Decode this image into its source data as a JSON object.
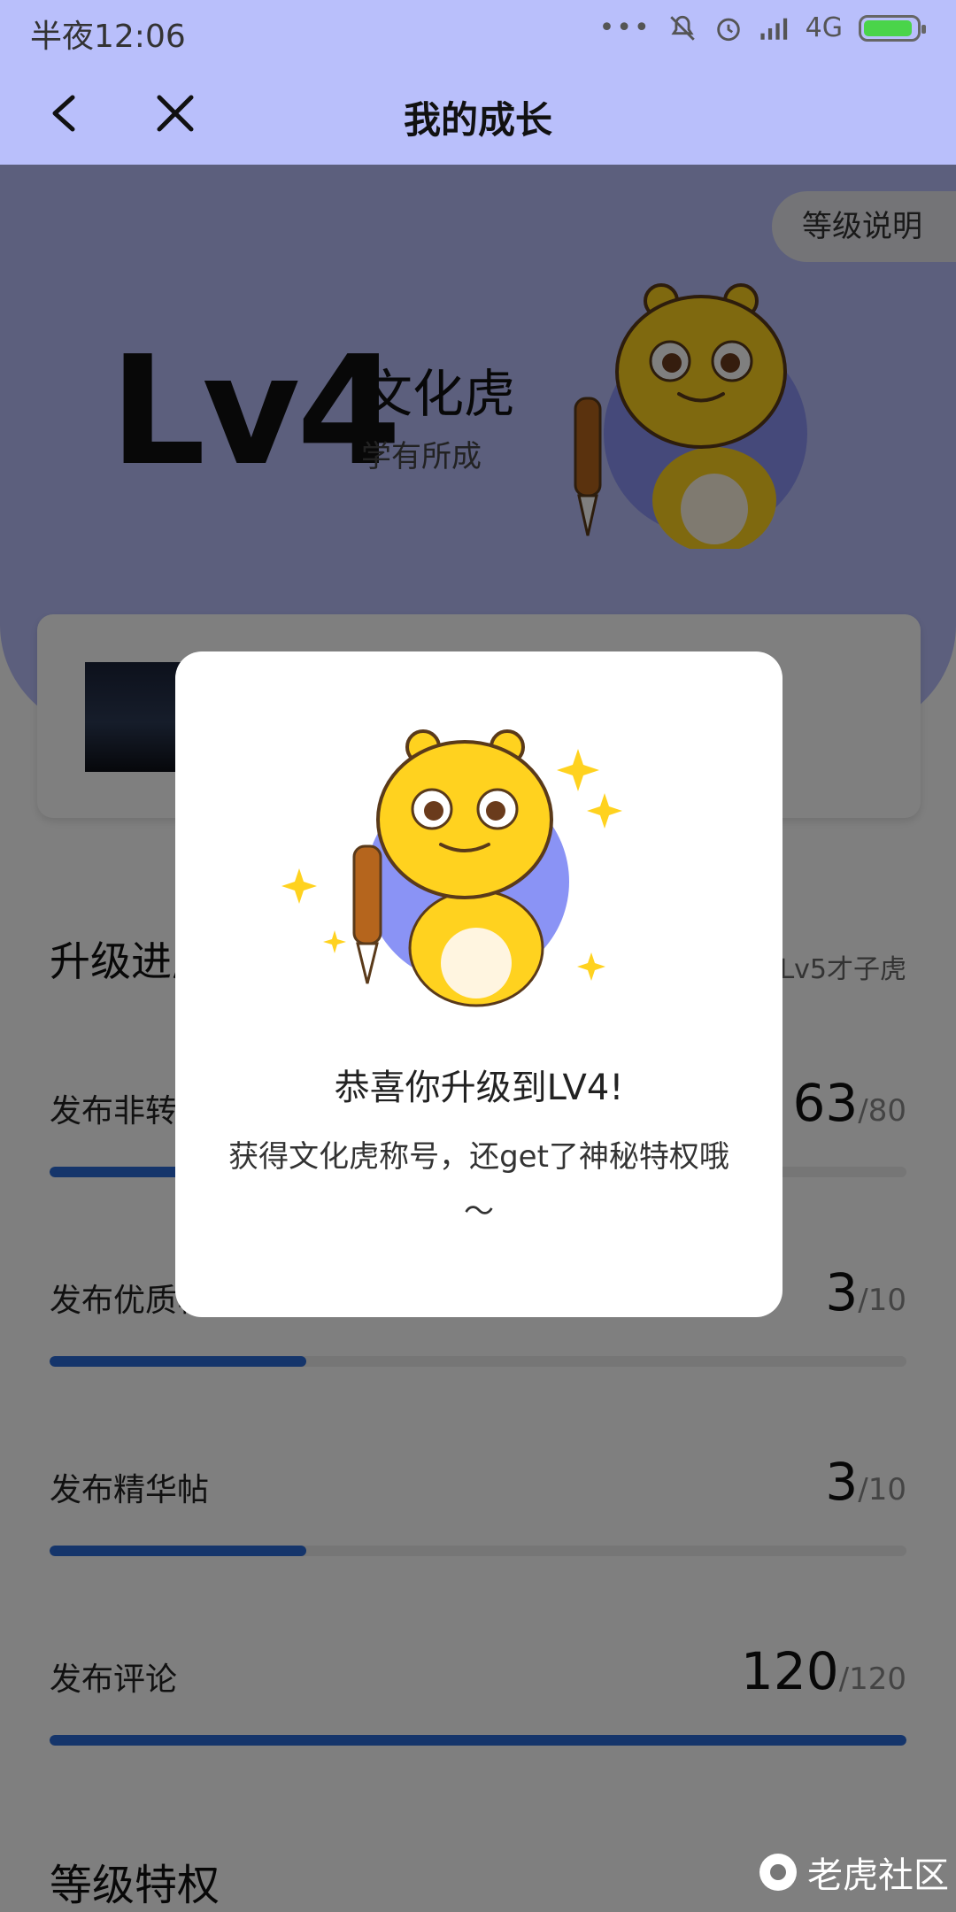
{
  "status_bar": {
    "time": "半夜12:06",
    "network": "4G",
    "dots": "•••"
  },
  "nav": {
    "title": "我的成长"
  },
  "header": {
    "level_button": "等级说明",
    "level": "Lv4",
    "level_name": "文化虎",
    "level_subtitle": "学有所成"
  },
  "progress": {
    "title": "升级进度",
    "next_level": "Lv5才子虎",
    "tasks": [
      {
        "label": "发布非转发帖",
        "current": "63",
        "max": "/80",
        "progress": 0.7875
      },
      {
        "label": "发布优质帖",
        "current": "3",
        "max": "/10",
        "progress": 0.3
      },
      {
        "label": "发布精华帖",
        "current": "3",
        "max": "/10",
        "progress": 0.3
      },
      {
        "label": "发布评论",
        "current": "120",
        "max": "/120",
        "progress": 1.0
      }
    ]
  },
  "privileges": {
    "title": "等级特权"
  },
  "dialog": {
    "title": "恭喜你升级到LV4!",
    "body": "获得文化虎称号，还get了神秘特权哦～"
  },
  "watermark": {
    "text": "老虎社区"
  },
  "colors": {
    "accent": "#2b6bd6",
    "header_bg": "#b9bffb",
    "mascot_yellow": "#ffd21f",
    "mascot_circle": "#8a93f5"
  }
}
